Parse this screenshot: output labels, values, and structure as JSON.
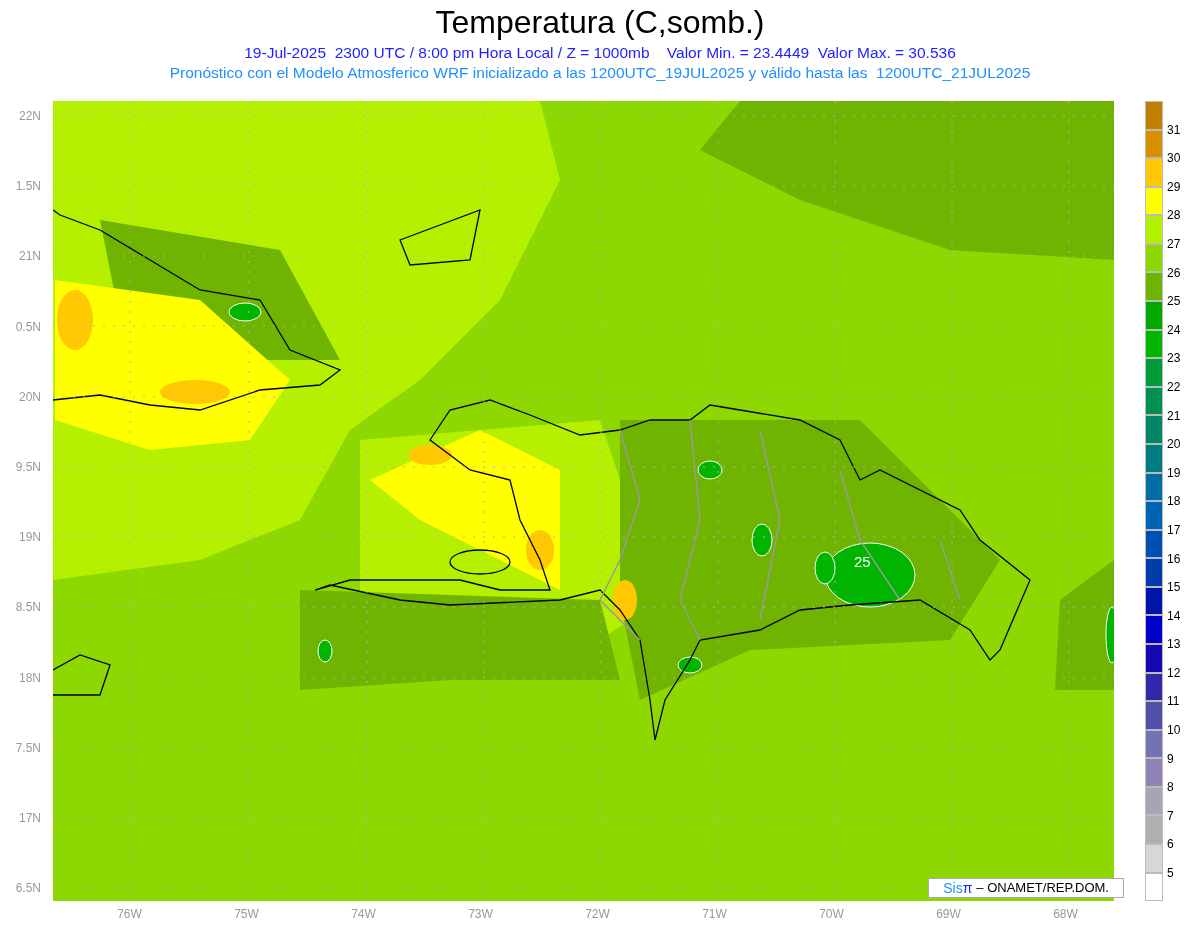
{
  "title": "Temperatura (C,somb.)",
  "subtitle_lines": [
    "19-Jul-2025  2300 UTC / 8:00 pm Hora Local / Z = 1000mb    Valor Min. = 23.4449  Valor Max. = 30.536",
    "Pronóstico con el Modelo Atmosferico WRF inicializado a las 1200UTC_19JUL2025 y válido hasta las  1200UTC_21JUL2025"
  ],
  "map": {
    "contour_label": "25"
  },
  "y_axis_labels": [
    "22N",
    "1.5N",
    "21N",
    "0.5N",
    "20N",
    "9.5N",
    "19N",
    "8.5N",
    "18N",
    "7.5N",
    "17N",
    "6.5N"
  ],
  "x_axis_labels": [
    "76W",
    "75W",
    "74W",
    "73W",
    "72W",
    "71W",
    "70W",
    "69W",
    "68W"
  ],
  "colorbar": {
    "bins": [
      {
        "color": "#bf7f00"
      },
      {
        "color": "#d99000"
      },
      {
        "color": "#ffc800"
      },
      {
        "color": "#ffff00"
      },
      {
        "color": "#b4f000"
      },
      {
        "color": "#8cd800"
      },
      {
        "color": "#6eb400"
      },
      {
        "color": "#00a800"
      },
      {
        "color": "#00b400"
      },
      {
        "color": "#009c3c"
      },
      {
        "color": "#009050"
      },
      {
        "color": "#008768"
      },
      {
        "color": "#007d82"
      },
      {
        "color": "#006ea5"
      },
      {
        "color": "#0064b4"
      },
      {
        "color": "#0050b4"
      },
      {
        "color": "#003caa"
      },
      {
        "color": "#0014aa"
      },
      {
        "color": "#0000c8"
      },
      {
        "color": "#140ab4"
      },
      {
        "color": "#3228aa"
      },
      {
        "color": "#5050aa"
      },
      {
        "color": "#7373b4"
      },
      {
        "color": "#9182b4"
      },
      {
        "color": "#a5a5b4"
      },
      {
        "color": "#afafaf"
      },
      {
        "color": "#d7d7d7"
      },
      {
        "color": "#ffffff"
      }
    ],
    "labels": [
      "31",
      "30",
      "29",
      "28",
      "27",
      "26",
      "25",
      "24",
      "23",
      "22",
      "21",
      "20",
      "19",
      "18",
      "17",
      "16",
      "15",
      "14",
      "13",
      "12",
      "11",
      "10",
      "9",
      "8",
      "7",
      "6",
      "5"
    ]
  },
  "credit": {
    "logo_prefix": "Sis",
    "logo_symbol": "π",
    "text": "– ONAMET/REP.DOM."
  }
}
